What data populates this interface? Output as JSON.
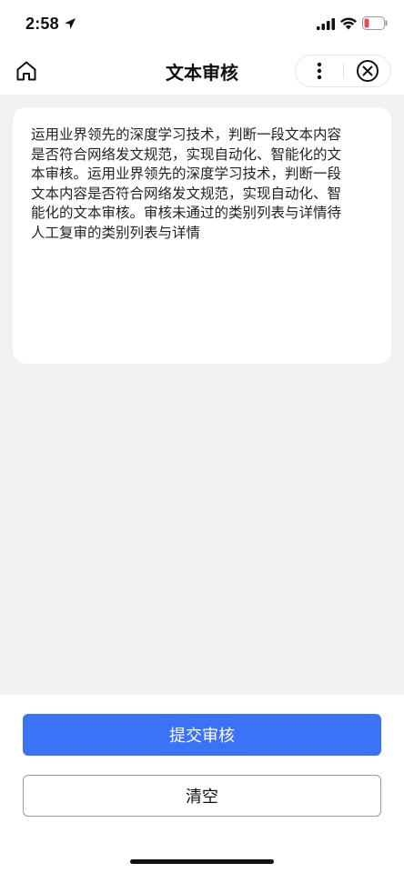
{
  "status_bar": {
    "time": "2:58",
    "icons": [
      "location-arrow-icon",
      "cellular-signal-icon",
      "wifi-icon",
      "battery-low-icon"
    ],
    "battery_color": "#e5484d"
  },
  "nav": {
    "title": "文本审核",
    "home_icon": "home-icon",
    "more_icon": "more-vertical-icon",
    "close_icon": "close-circle-icon"
  },
  "content": {
    "text": "运用业界领先的深度学习技术，判断一段文本内容是否符合网络发文规范，实现自动化、智能化的文本审核。运用业界领先的深度学习技术，判断一段文本内容是否符合网络发文规范，实现自动化、智能化的文本审核。审核未通过的类别列表与详情待人工复审的类别列表与详情"
  },
  "actions": {
    "submit_label": "提交审核",
    "clear_label": "清空",
    "accent_color": "#3b73f7"
  }
}
